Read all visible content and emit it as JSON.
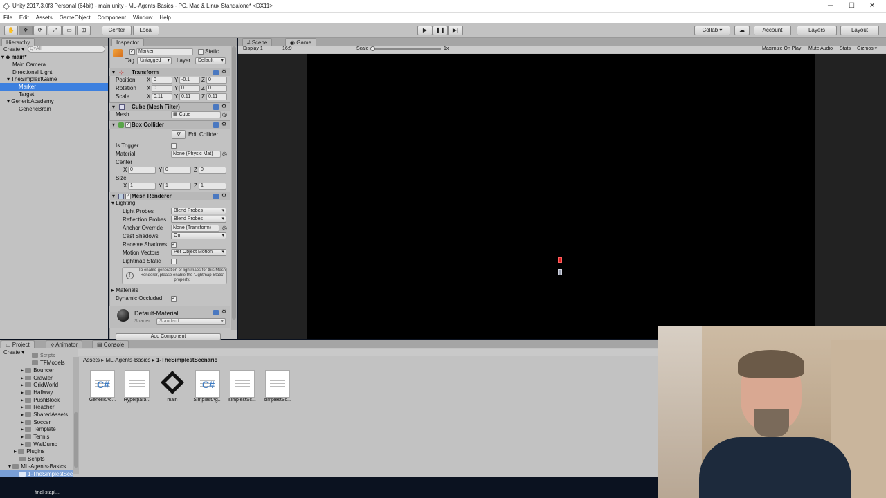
{
  "window": {
    "title": "Unity 2017.3.0f3 Personal (64bit) - main.unity - ML-Agents-Basics - PC, Mac & Linux Standalone* <DX11>"
  },
  "menu": [
    "File",
    "Edit",
    "Assets",
    "GameObject",
    "Component",
    "Window",
    "Help"
  ],
  "toolbar": {
    "center": "Center",
    "local": "Local",
    "collab": "Collab ▾",
    "account": "Account",
    "layers": "Layers",
    "layout": "Layout"
  },
  "hierarchy": {
    "tab": "Hierarchy",
    "create": "Create ▾",
    "search_placeholder": "Q▾All",
    "scene": "main*",
    "items": [
      "Main Camera",
      "Directional Light",
      "TheSimplestGame",
      "Marker",
      "Target",
      "GenericAcademy",
      "GenericBrain"
    ]
  },
  "inspector": {
    "tab": "Inspector",
    "name": "Marker",
    "static": "Static",
    "tag_label": "Tag",
    "tag_value": "Untagged",
    "layer_label": "Layer",
    "layer_value": "Default",
    "transform": {
      "title": "Transform",
      "position": "Position",
      "rotation": "Rotation",
      "scale": "Scale",
      "pos": [
        "0",
        "-0.1",
        "0"
      ],
      "rot": [
        "0",
        "0",
        "0"
      ],
      "scl": [
        "0.11",
        "0.11",
        "0.11"
      ]
    },
    "mesh_filter": {
      "title": "Cube (Mesh Filter)",
      "mesh_label": "Mesh",
      "mesh_value": "Cube"
    },
    "box_collider": {
      "title": "Box Collider",
      "edit": "Edit Collider",
      "is_trigger": "Is Trigger",
      "material_label": "Material",
      "material_value": "None (Physic Mat)",
      "center": "Center",
      "c": [
        "0",
        "0",
        "0"
      ],
      "size": "Size",
      "s": [
        "1",
        "1",
        "1"
      ]
    },
    "mesh_renderer": {
      "title": "Mesh Renderer",
      "lighting": "Lighting",
      "light_probes": "Light Probes",
      "light_probes_value": "Blend Probes",
      "reflection_probes": "Reflection Probes",
      "reflection_probes_value": "Blend Probes",
      "anchor_override": "Anchor Override",
      "anchor_value": "None (Transform)",
      "cast_shadows": "Cast Shadows",
      "cast_value": "On",
      "receive_shadows": "Receive Shadows",
      "motion_vectors": "Motion Vectors",
      "motion_value": "Per Object Motion",
      "lightmap_static": "Lightmap Static",
      "info": "To enable generation of lightmaps for this Mesh Renderer, please enable the 'Lightmap Static' property.",
      "materials": "Materials",
      "dynamic_occluded": "Dynamic Occluded"
    },
    "material": {
      "name": "Default-Material",
      "shader_label": "Shader",
      "shader_value": "Standard"
    },
    "add_component": "Add Component"
  },
  "axes": {
    "x": "X",
    "y": "Y",
    "z": "Z"
  },
  "game": {
    "tab_scene": "Scene",
    "tab_game": "Game",
    "display": "Display 1",
    "aspect": "16:9",
    "scale_label": "Scale",
    "scale_value": "1x",
    "maximize": "Maximize On Play",
    "mute": "Mute Audio",
    "stats": "Stats",
    "gizmos": "Gizmos ▾"
  },
  "project": {
    "tab_project": "Project",
    "tab_animator": "Animator",
    "tab_console": "Console",
    "create": "Create ▾",
    "folders": [
      "Scripts",
      "TFModels",
      "Bouncer",
      "Crawler",
      "GridWorld",
      "Hallway",
      "PushBlock",
      "Reacher",
      "SharedAssets",
      "Soccer",
      "Template",
      "Tennis",
      "WallJump",
      "Plugins",
      "Scripts",
      "ML-Agents-Basics",
      "1-TheSimplestSce"
    ],
    "breadcrumb": [
      "Assets",
      "ML-Agents-Basics",
      "1-TheSimplestScenario"
    ],
    "assets": [
      "GenericAc...",
      "Hyperpara...",
      "main",
      "SimplestAg...",
      "simplestSc...",
      "simplestSc..."
    ]
  },
  "taskbar": {
    "item": "final-stapl..."
  },
  "colors": {
    "accent": "#3d80df",
    "panel": "#c2c2c2",
    "game_bg": "#000000",
    "marker": "#e02020"
  }
}
